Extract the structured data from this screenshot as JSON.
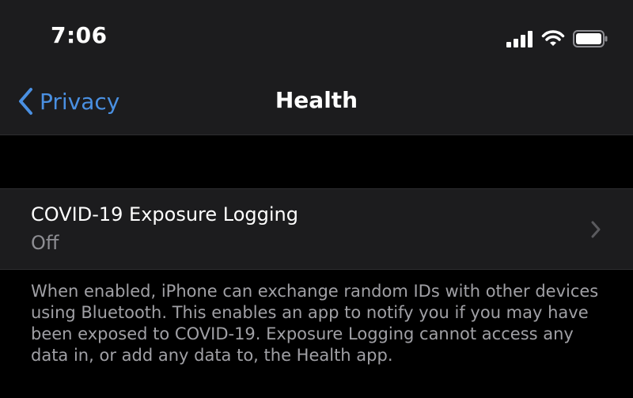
{
  "status_bar": {
    "time": "7:06",
    "icons": [
      "cellular-signal-icon",
      "wifi-icon",
      "battery-icon"
    ]
  },
  "nav": {
    "back_label": "Privacy",
    "title": "Health"
  },
  "cell": {
    "title": "COVID-19 Exposure Logging",
    "subtitle": "Off"
  },
  "footer": {
    "text": "When enabled, iPhone can exchange random IDs with other devices using Bluetooth. This enables an app to notify you if you may have been exposed to COVID-19. Exposure Logging cannot access any data in, or add any data to, the Health app."
  },
  "colors": {
    "background": "#000000",
    "surface": "#1c1c1e",
    "accent": "#4a90e2",
    "secondary_text": "#8e8e93"
  }
}
